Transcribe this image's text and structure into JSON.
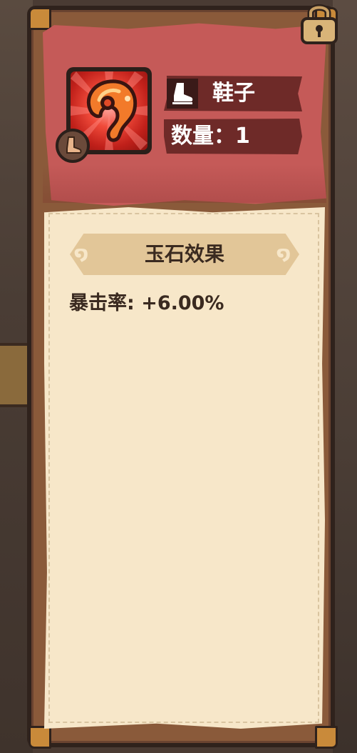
{
  "item": {
    "name": "鞋子",
    "quantity_text": "数量：1",
    "slot_icon": "boot-icon",
    "gem_icon": "red-jade-gem-icon"
  },
  "effects": {
    "title": "玉石效果",
    "stats": [
      {
        "text": "暴击率: +6.00%"
      }
    ]
  },
  "colors": {
    "header_red": "#c55a58",
    "label_bar": "#6e2a28",
    "paper": "#f7e7c9",
    "banner": "#e2c698",
    "text_dark": "#3a2a20",
    "gem_red": "#e8352a",
    "gem_orange": "#f27a2a"
  },
  "lock_icon": "padlock-icon"
}
